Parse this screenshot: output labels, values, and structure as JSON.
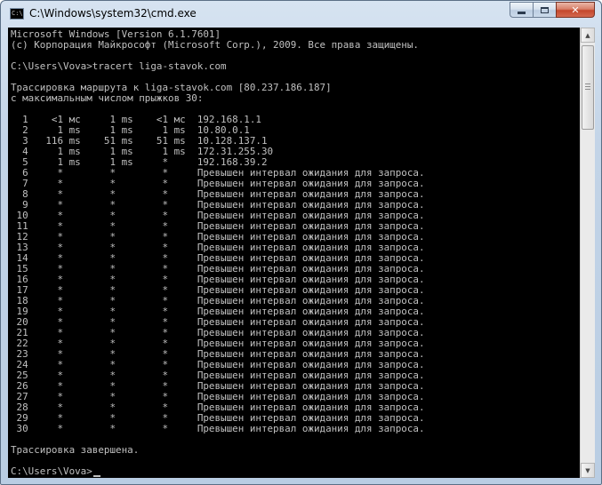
{
  "window": {
    "title": "C:\\Windows\\system32\\cmd.exe",
    "icon_text": "C:\\"
  },
  "console": {
    "lines": [
      "Microsoft Windows [Version 6.1.7601]",
      "(c) Корпорация Майкрософт (Microsoft Corp.), 2009. Все права защищены.",
      "",
      "C:\\Users\\Vova>tracert liga-stavok.com",
      "",
      "Трассировка маршрута к liga-stavok.com [80.237.186.187]",
      "с максимальным числом прыжков 30:",
      "",
      "  1    <1 мс     1 ms    <1 мс  192.168.1.1",
      "  2     1 ms     1 ms     1 ms  10.80.0.1",
      "  3   116 ms    51 ms    51 ms  10.128.137.1",
      "  4     1 ms     1 ms     1 ms  172.31.255.30",
      "  5     1 ms     1 ms     *     192.168.39.2",
      "  6     *        *        *     Превышен интервал ожидания для запроса.",
      "  7     *        *        *     Превышен интервал ожидания для запроса.",
      "  8     *        *        *     Превышен интервал ожидания для запроса.",
      "  9     *        *        *     Превышен интервал ожидания для запроса.",
      " 10     *        *        *     Превышен интервал ожидания для запроса.",
      " 11     *        *        *     Превышен интервал ожидания для запроса.",
      " 12     *        *        *     Превышен интервал ожидания для запроса.",
      " 13     *        *        *     Превышен интервал ожидания для запроса.",
      " 14     *        *        *     Превышен интервал ожидания для запроса.",
      " 15     *        *        *     Превышен интервал ожидания для запроса.",
      " 16     *        *        *     Превышен интервал ожидания для запроса.",
      " 17     *        *        *     Превышен интервал ожидания для запроса.",
      " 18     *        *        *     Превышен интервал ожидания для запроса.",
      " 19     *        *        *     Превышен интервал ожидания для запроса.",
      " 20     *        *        *     Превышен интервал ожидания для запроса.",
      " 21     *        *        *     Превышен интервал ожидания для запроса.",
      " 22     *        *        *     Превышен интервал ожидания для запроса.",
      " 23     *        *        *     Превышен интервал ожидания для запроса.",
      " 24     *        *        *     Превышен интервал ожидания для запроса.",
      " 25     *        *        *     Превышен интервал ожидания для запроса.",
      " 26     *        *        *     Превышен интервал ожидания для запроса.",
      " 27     *        *        *     Превышен интервал ожидания для запроса.",
      " 28     *        *        *     Превышен интервал ожидания для запроса.",
      " 29     *        *        *     Превышен интервал ожидания для запроса.",
      " 30     *        *        *     Превышен интервал ожидания для запроса.",
      "",
      "Трассировка завершена.",
      "",
      "C:\\Users\\Vova>"
    ]
  },
  "colors": {
    "console_background": "#000000",
    "console_text": "#c0c0c0",
    "close_button": "#c4472c"
  },
  "icons": [
    "cmd-app-icon",
    "minimize-icon",
    "maximize-icon",
    "close-icon",
    "scroll-up-arrow-icon",
    "scroll-down-arrow-icon"
  ]
}
